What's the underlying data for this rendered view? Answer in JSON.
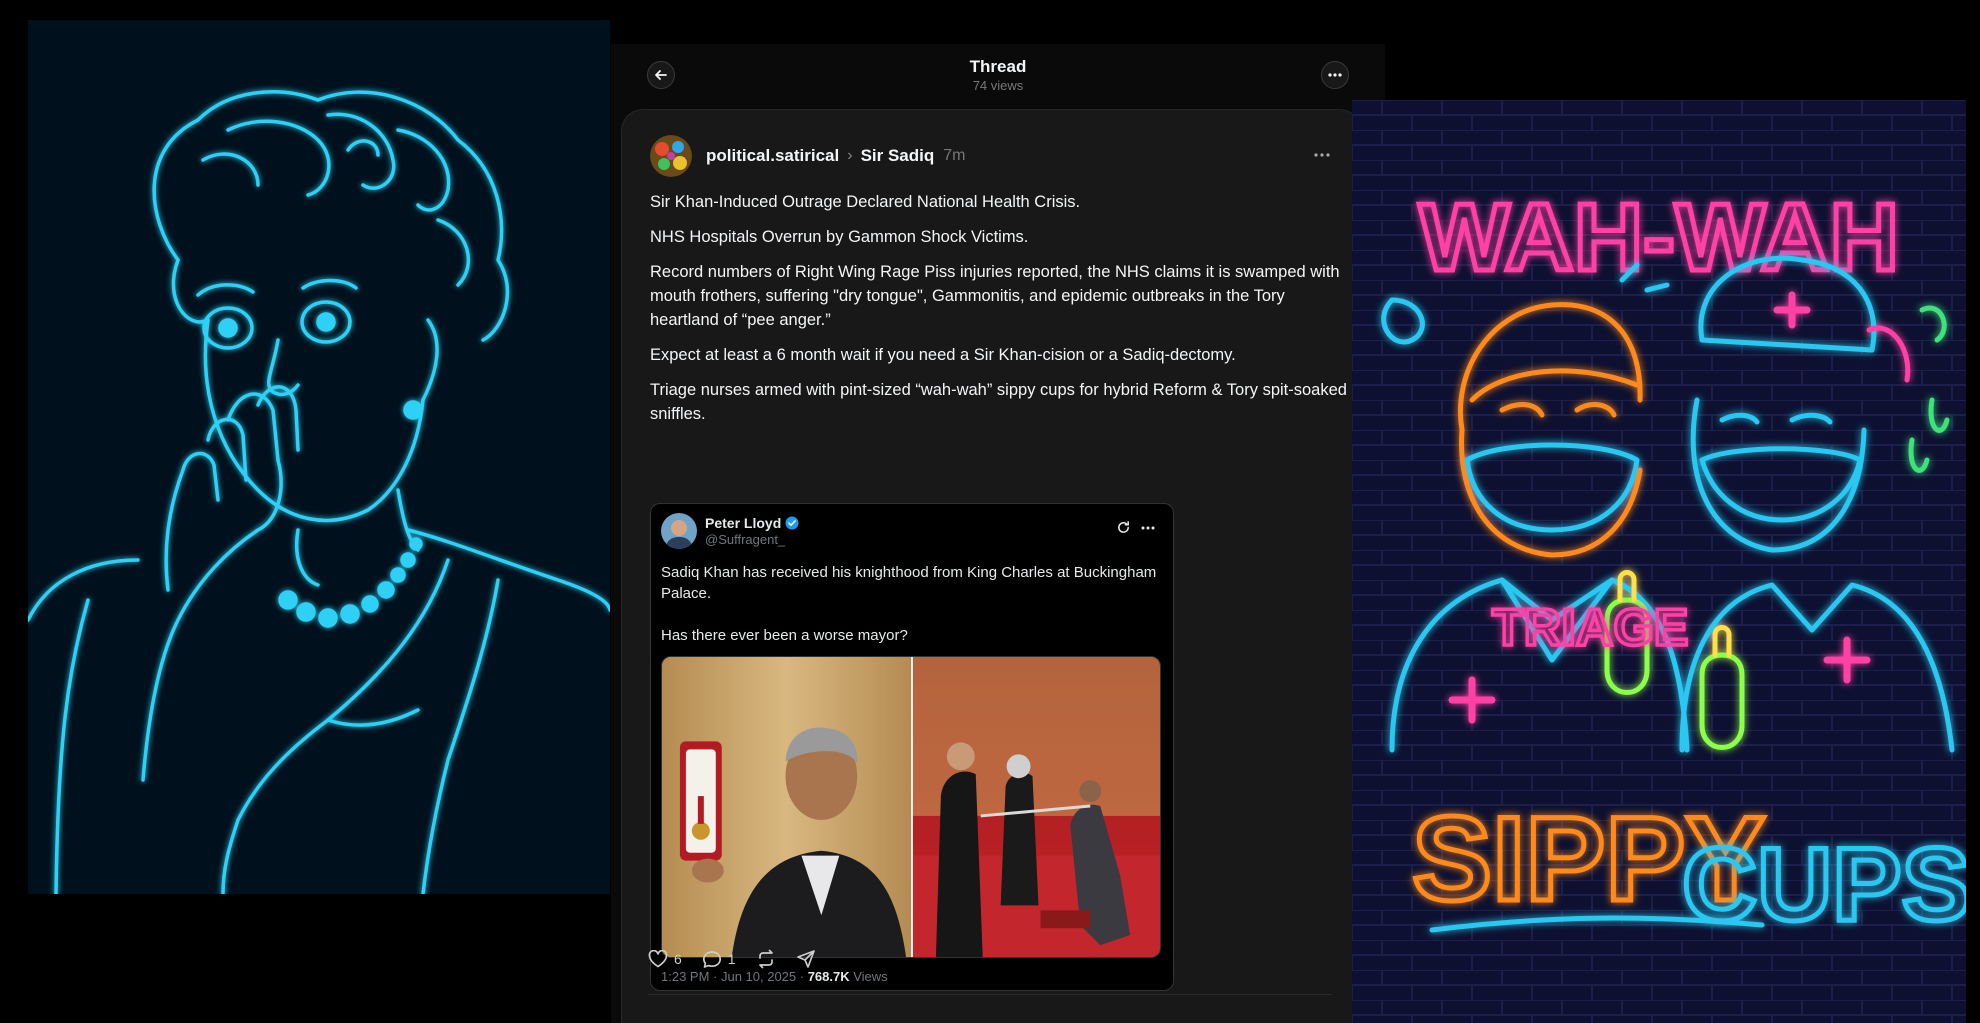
{
  "thread": {
    "title": "Thread",
    "views": "74 views"
  },
  "post": {
    "author": "political.satirical",
    "topic": "Sir Sadiq",
    "time": "7m",
    "paragraphs": [
      "Sir Khan-Induced Outrage Declared National Health Crisis.",
      "NHS Hospitals Overrun by Gammon Shock Victims.",
      "Record numbers of Right Wing Rage Piss injuries reported, the NHS claims it is swamped with mouth frothers, suffering \"dry tongue\", Gammonitis, and epidemic outbreaks in the Tory heartland of “pee anger.”",
      "Expect at least a 6 month wait if you need a Sir Khan-cision or a Sadiq-dectomy.",
      "Triage nurses armed with pint-sized “wah-wah” sippy cups for hybrid Reform & Tory spit-soaked sniffles."
    ],
    "likes": "6",
    "replies": "1"
  },
  "quote": {
    "name": "Peter Lloyd",
    "handle": "@Suffragent_",
    "text_line1": "Sadiq Khan has received his knighthood from King Charles at Buckingham Palace.",
    "text_line2": "Has there ever been a worse mayor?",
    "meta_date": "1:23 PM · Jun 10, 2025 · ",
    "meta_views_count": "768.7K",
    "meta_views_label": " Views"
  },
  "art_right": {
    "sign_top": "WAH-WAH",
    "sign_triage": "TRIAGE",
    "sign_sippy": "SIPPY",
    "sign_cups": "CUPS"
  },
  "colors": {
    "panel_bg": "#0a0a0a",
    "card_bg": "#181818",
    "neon_cyan": "#29c8f0",
    "neon_pink": "#ff3fa4",
    "neon_orange": "#ff8a1e"
  }
}
